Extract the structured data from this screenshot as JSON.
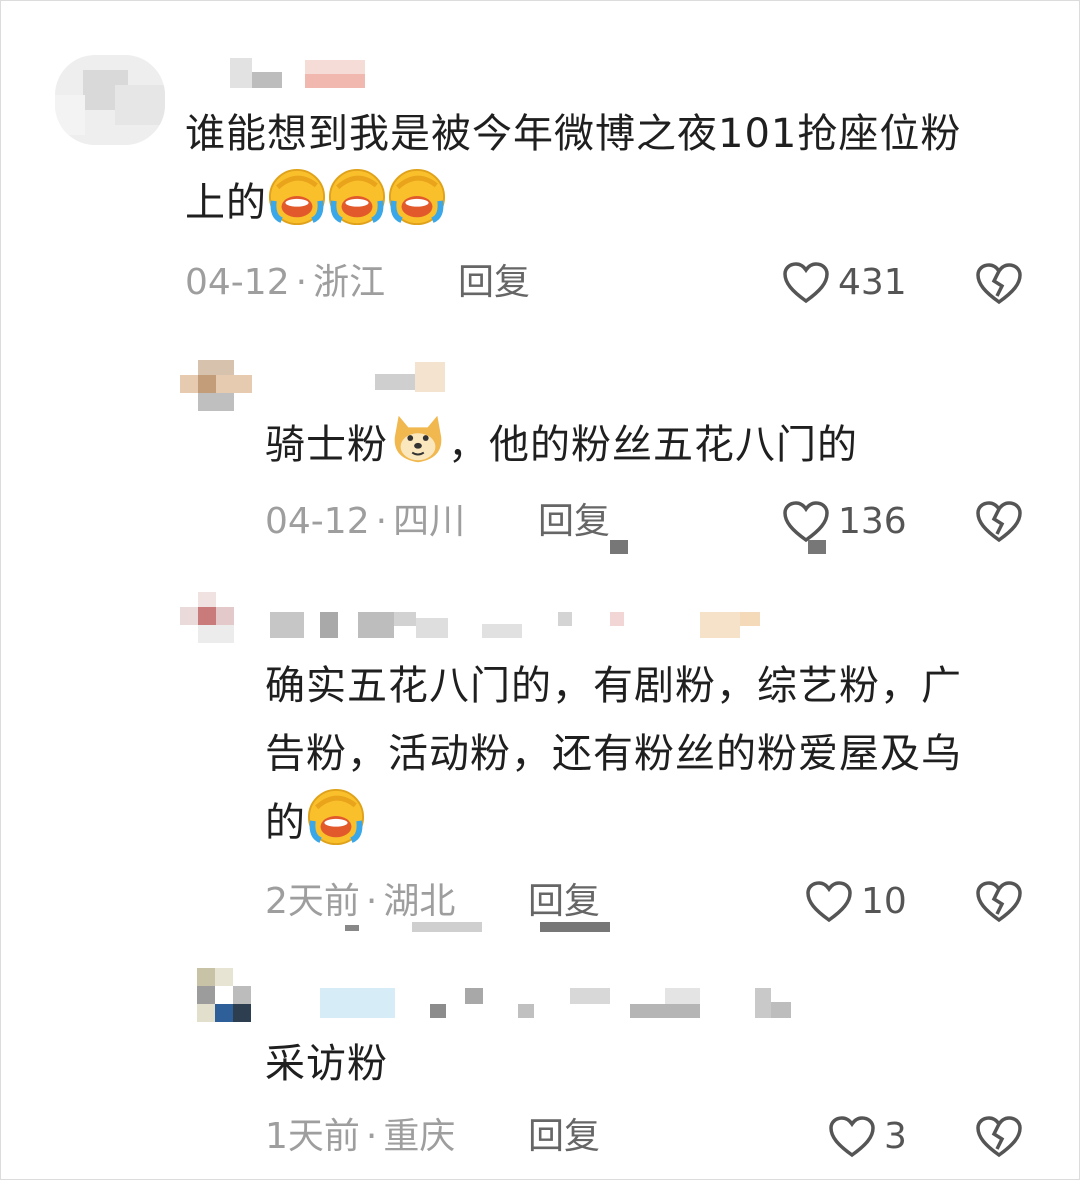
{
  "comments": [
    {
      "text": "谁能想到我是被今年微博之夜101抢座位粉",
      "text2": "上的",
      "time": "04-12",
      "location": "浙江",
      "reply_label": "回复",
      "likes": "431",
      "emoji": [
        "facepalm-cry-emoji",
        "facepalm-cry-emoji",
        "facepalm-cry-emoji"
      ]
    },
    {
      "text_before_emoji": "骑士粉",
      "text_after_emoji": "，他的粉丝五花八门的",
      "time": "04-12",
      "location": "四川",
      "reply_label": "回复",
      "likes": "136",
      "emoji": [
        "doge-emoji"
      ]
    },
    {
      "line1": "确实五花八门的，有剧粉，综艺粉，广",
      "line2": "告粉，活动粉，还有粉丝的粉爱屋及乌",
      "line3": "的",
      "time": "2天前",
      "location": "湖北",
      "reply_label": "回复",
      "likes": "10",
      "emoji": [
        "facepalm-cry-emoji"
      ]
    },
    {
      "text": "采访粉",
      "time": "1天前",
      "location": "重庆",
      "reply_label": "回复",
      "likes": "3"
    }
  ],
  "colors": {
    "text": "#1f1f1f",
    "meta": "#9e9e9e",
    "icon": "#555555"
  }
}
